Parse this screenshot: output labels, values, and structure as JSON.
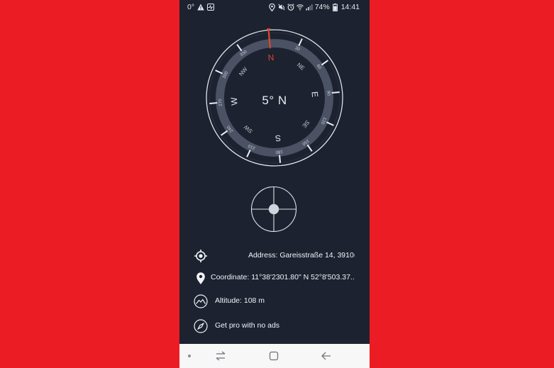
{
  "status_bar": {
    "temperature": "0°",
    "battery": "74%",
    "time": "14:41"
  },
  "compass": {
    "heading": "5° N",
    "cardinals": {
      "n": "N",
      "e": "E",
      "s": "S",
      "w": "W"
    },
    "intercardinals": {
      "ne": "NE",
      "se": "SE",
      "sw": "SW",
      "nw": "NW"
    },
    "degrees": [
      "30",
      "60",
      "90",
      "120",
      "150",
      "180",
      "210",
      "240",
      "270",
      "300",
      "330"
    ],
    "needle_color": "#e0442b"
  },
  "info": {
    "address": "Address: Gareisstraße 14, 3910(",
    "coordinate": "Coordinate: 11°38'2301.80\" N 52°8'503.37..",
    "altitude": "Altitude: 108 m",
    "pro": "Get pro with no ads"
  },
  "icons": {
    "status_left": [
      "warning-icon",
      "activity-icon"
    ],
    "status_right": [
      "location-icon",
      "mute-icon",
      "alarm-icon",
      "wifi-icon",
      "signal-icon",
      "battery-icon"
    ],
    "rows": [
      "crosshair-icon",
      "location-pin-icon",
      "mountain-icon",
      "compass-icon"
    ],
    "nav": [
      "dot-icon",
      "recent-apps-icon",
      "home-icon",
      "back-icon"
    ]
  },
  "colors": {
    "background": "#ec1c24",
    "panel": "#1c2230",
    "ring": "#4a5263"
  }
}
